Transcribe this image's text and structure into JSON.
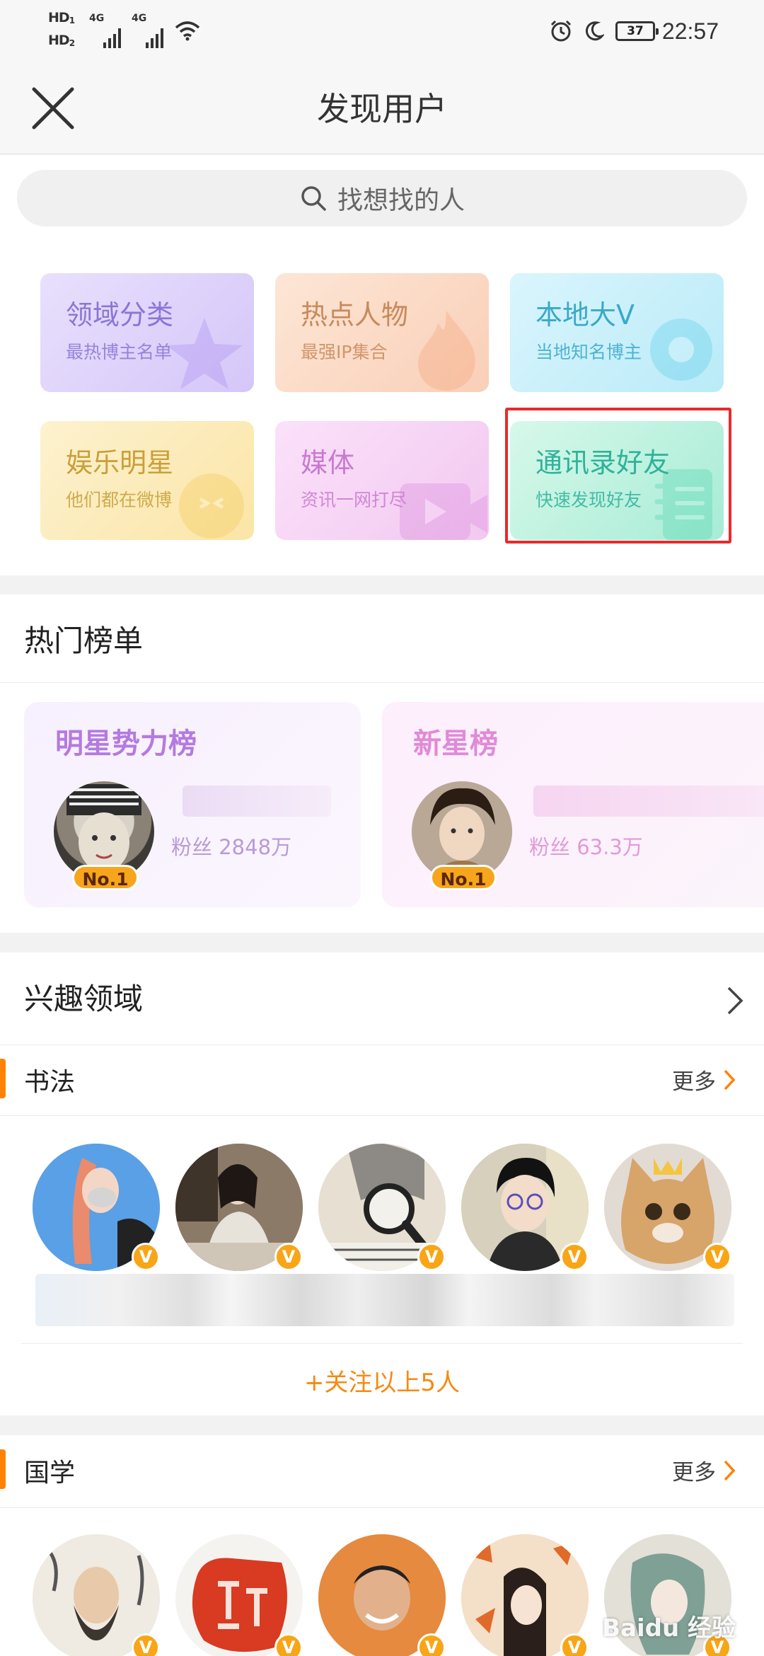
{
  "status_bar": {
    "hd1": "HD",
    "hd1_sub": "1",
    "hd2": "HD",
    "hd2_sub": "2",
    "net1": "4G",
    "net2": "4G",
    "battery": "37",
    "time": "22:57"
  },
  "header": {
    "title": "发现用户",
    "close_icon": "close-icon"
  },
  "search": {
    "placeholder": "找想找的人",
    "icon": "search-icon"
  },
  "categories": [
    {
      "title": "领域分类",
      "subtitle": "最热博主名单",
      "color": "#8a76d6",
      "bg": "#d9cdfa",
      "icon": "star-icon"
    },
    {
      "title": "热点人物",
      "subtitle": "最强IP集合",
      "color": "#c88a5a",
      "bg": "#fbd9c3",
      "icon": "flame-icon"
    },
    {
      "title": "本地大V",
      "subtitle": "当地知名博主",
      "color": "#3aa9c9",
      "bg": "#c8effa",
      "icon": "location-icon"
    },
    {
      "title": "娱乐明星",
      "subtitle": "他们都在微博",
      "color": "#c9a03a",
      "bg": "#fcecb8",
      "icon": "smile-icon"
    },
    {
      "title": "媒体",
      "subtitle": "资讯一网打尽",
      "color": "#c97ad0",
      "bg": "#f5d4f4",
      "icon": "video-icon"
    },
    {
      "title": "通讯录好友",
      "subtitle": "快速发现好友",
      "color": "#2fb29a",
      "bg": "#bff3e2",
      "icon": "contacts-icon"
    }
  ],
  "hot_list": {
    "title": "热门榜单",
    "cards": [
      {
        "title": "明星势力榜",
        "badge": "No.1",
        "fans": "粉丝 2848万",
        "accent": "#b47ae0"
      },
      {
        "title": "新星榜",
        "badge": "No.1",
        "fans": "粉丝 63.3万",
        "accent": "#e08ad8"
      }
    ]
  },
  "interest": {
    "title": "兴趣领域"
  },
  "groups": [
    {
      "title": "书法",
      "more": "更多",
      "follow_all": "+关注以上5人",
      "badge": "V"
    },
    {
      "title": "国学",
      "more": "更多",
      "badge": "V"
    }
  ],
  "watermark": "Baidu 经验"
}
